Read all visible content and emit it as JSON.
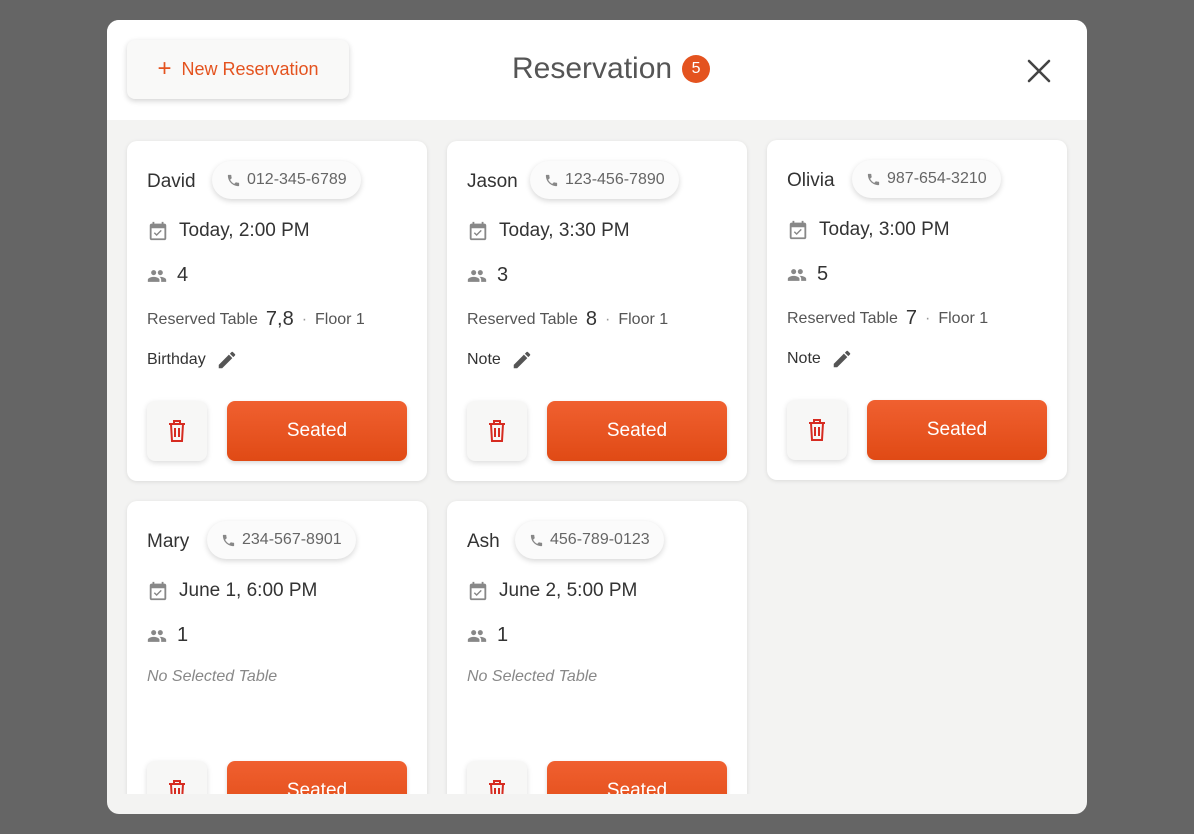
{
  "header": {
    "new_button_label": "New Reservation",
    "title": "Reservation",
    "count": "5"
  },
  "colors": {
    "accent": "#e4531f",
    "overlay": "#656565"
  },
  "reservations": [
    {
      "name": "David",
      "phone": "012-345-6789",
      "datetime": "Today, 2:00 PM",
      "guests": "4",
      "table_label": "Reserved Table",
      "table": "7,8",
      "floor": "Floor 1",
      "note": "Birthday",
      "action": "Seated"
    },
    {
      "name": "Jason",
      "phone": "123-456-7890",
      "datetime": "Today, 3:30 PM",
      "guests": "3",
      "table_label": "Reserved Table",
      "table": "8",
      "floor": "Floor 1",
      "note": "Note",
      "action": "Seated"
    },
    {
      "name": "Olivia",
      "phone": "987-654-3210",
      "datetime": "Today, 3:00 PM",
      "guests": "5",
      "table_label": "Reserved Table",
      "table": "7",
      "floor": "Floor 1",
      "note": "Note",
      "action": "Seated"
    },
    {
      "name": "Mary",
      "phone": "234-567-8901",
      "datetime": "June 1, 6:00 PM",
      "guests": "1",
      "no_table": "No Selected Table",
      "action": "Seated"
    },
    {
      "name": "Ash",
      "phone": "456-789-0123",
      "datetime": "June 2, 5:00 PM",
      "guests": "1",
      "no_table": "No Selected Table",
      "action": "Seated"
    }
  ],
  "icons": {
    "phone": "phone-icon",
    "calendar": "calendar-check-icon",
    "guests": "people-icon",
    "edit": "pencil-icon",
    "delete": "trash-icon",
    "close": "close-icon",
    "add": "plus-icon"
  }
}
